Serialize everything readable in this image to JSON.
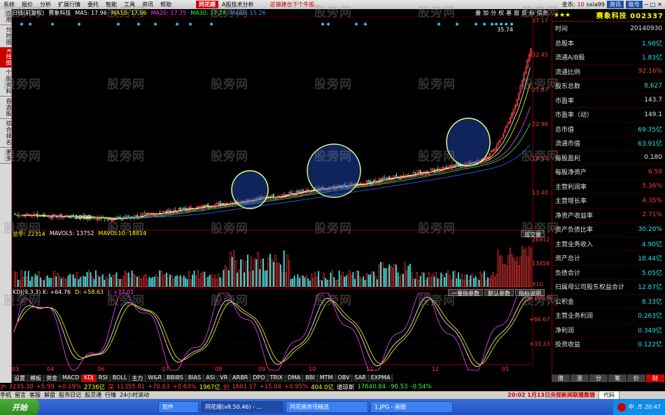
{
  "menu": {
    "items": [
      "系统",
      "报价",
      "分析",
      "扩展行情",
      "委托",
      "智能",
      "工具",
      "资讯",
      "帮助"
    ],
    "brand": "同花顺",
    "subtitle": "A股技术分析",
    "ticker": "这锑建仓下个牛股...",
    "gold_label": "金币:",
    "gold_value": "10",
    "user": "sxia99",
    "zixun": "资讯",
    "account": "账号"
  },
  "left_tabs": [
    {
      "label": "应用",
      "active": false
    },
    {
      "label": "分时图",
      "active": false
    },
    {
      "label": "K线图",
      "active": true
    },
    {
      "label": "个股资料",
      "active": false
    },
    {
      "label": "自选股",
      "active": false
    },
    {
      "label": "综合排名",
      "active": false
    },
    {
      "label": "更多",
      "active": false
    }
  ],
  "ma_bar": {
    "period": "日线(前复权)",
    "name": "赛象科技",
    "ma5": "MA5: 17.96",
    "ma10": "MA10: 17.96",
    "ma20": "MA20: 17.75",
    "ma30": "MA30: 17.28",
    "ma60": "MA60: 15.26",
    "tools": [
      "叠",
      "加",
      "分",
      "权",
      "基",
      "窗",
      "反",
      "标",
      "信息"
    ]
  },
  "price_axis": [
    "37.17",
    "32.45",
    "27.87",
    "22.96",
    "18.10",
    "13.40"
  ],
  "price_marks": {
    "high": "35.74",
    "low": "10.09"
  },
  "vol_bar": {
    "label": "总手: 22314",
    "mavol5": "MAVOL5: 13752",
    "mavol10": "MAVOL10: 18814",
    "selector": "成交量"
  },
  "vol_axis": [
    "26912",
    "13456",
    "X10"
  ],
  "kdj_bar": {
    "label": "KDJ(9,3,3) K: +64.76",
    "d": "D: +58.63",
    "j": "J: +77.01"
  },
  "kdj_buttons": [
    "一量指参数",
    "默认参数",
    "指标说明"
  ],
  "kdj_axis": [
    "+100.00",
    "+66.67",
    "+33.33"
  ],
  "date_axis": [
    "03",
    "04",
    "06",
    "07",
    "08",
    "09",
    "10",
    "11",
    "12",
    "01"
  ],
  "bottom_tabs": [
    {
      "label": "设置",
      "active": false
    },
    {
      "label": "模板",
      "active": false
    },
    {
      "label": "资金",
      "active": false
    },
    {
      "label": "MACD",
      "active": false
    },
    {
      "label": "KDJ",
      "active": true
    },
    {
      "label": "RSI",
      "active": false
    },
    {
      "label": "BOLL",
      "active": false
    },
    {
      "label": "主力",
      "active": false
    },
    {
      "label": "W&R",
      "active": false
    },
    {
      "label": "BBIBS",
      "active": false
    },
    {
      "label": "BIAS",
      "active": false
    },
    {
      "label": "ASI",
      "active": false
    },
    {
      "label": "VR",
      "active": false
    },
    {
      "label": "ARBR",
      "active": false
    },
    {
      "label": "DPO",
      "active": false
    },
    {
      "label": "TRIX",
      "active": false
    },
    {
      "label": "DMA",
      "active": false
    },
    {
      "label": "BBI",
      "active": false
    },
    {
      "label": "MTM",
      "active": false
    },
    {
      "label": "OBV",
      "active": false
    },
    {
      "label": "SAR",
      "active": false
    },
    {
      "label": "EXPMA",
      "active": false
    }
  ],
  "stock_panel": {
    "name": "赛象科技",
    "code": "002337",
    "rows": [
      {
        "label": "时间",
        "value": "20140930",
        "cls": ""
      },
      {
        "label": "总股本",
        "value": "1.98亿",
        "cls": "cyan"
      },
      {
        "label": "流通A/B股",
        "value": "1.83亿",
        "cls": "cyan"
      },
      {
        "label": "流通比例",
        "value": "92.16%",
        "cls": "red"
      },
      {
        "label": "股东总数",
        "value": "8,627",
        "cls": "cyan"
      },
      {
        "label": "市盈率",
        "value": "143.7",
        "cls": ""
      },
      {
        "label": "市盈率（动）",
        "value": "149.1",
        "cls": ""
      },
      {
        "label": "总市值",
        "value": "69.35亿",
        "cls": "cyan"
      },
      {
        "label": "流通市值",
        "value": "63.91亿",
        "cls": "cyan"
      },
      {
        "label": "每股盈利",
        "value": "0.180",
        "cls": ""
      },
      {
        "label": "每股净资产",
        "value": "6.50",
        "cls": "red"
      },
      {
        "label": "主营利润率",
        "value": "5.36%",
        "cls": "red"
      },
      {
        "label": "主营增长率",
        "value": "4.35%",
        "cls": "red"
      },
      {
        "label": "净资产收益率",
        "value": "2.71%",
        "cls": "red"
      },
      {
        "label": "资产负债比率",
        "value": "30.20%",
        "cls": "cyan"
      },
      {
        "label": "主营业务收入",
        "value": "4.90亿",
        "cls": "cyan"
      },
      {
        "label": "资产总计",
        "value": "18.44亿",
        "cls": "cyan"
      },
      {
        "label": "负债合计",
        "value": "5.05亿",
        "cls": "cyan"
      },
      {
        "label": "归属母公司股东权益合计",
        "value": "12.87亿",
        "cls": "cyan"
      },
      {
        "label": "公积金",
        "value": "8.33亿",
        "cls": "cyan"
      },
      {
        "label": "主营业务利润",
        "value": "0.263亿",
        "cls": "cyan"
      },
      {
        "label": "净利润",
        "value": "0.349亿",
        "cls": "cyan"
      },
      {
        "label": "投资收益",
        "value": "0.122亿",
        "cls": "cyan"
      }
    ],
    "tabs": [
      "值",
      "涨",
      "分",
      "笔",
      "价",
      "财"
    ]
  },
  "status": {
    "sh_label": "沪",
    "sh_idx": "3235.30",
    "sh_chg": "+5.99",
    "sh_pct": "+0.19%",
    "sh_amt": "2736亿",
    "sz_label": "深",
    "sz_idx": "11355.81",
    "sz_chg": "+70.63",
    "sz_pct": "+0.63%",
    "sz_amt": "1967亿",
    "cy_label": "创",
    "cy_idx": "1601.17",
    "cy_chg": "+15.04",
    "cy_pct": "+0.95%",
    "cy_amt": "404.0亿",
    "dj_label": "道琼斯",
    "dj_idx": "17640.84",
    "dj_chg": "-96.53",
    "dj_pct": "-0.54%"
  },
  "status2": {
    "items": [
      "手机",
      "留言",
      "客服",
      "解盘",
      "股市日记",
      "股灵通",
      "行情",
      "24小时滚动"
    ],
    "news": "20:02  1月13日央视新闻联播集锦",
    "code_label": "代码"
  },
  "taskbar": {
    "start": "开始",
    "tasks": [
      {
        "label": "软件",
        "active": false
      },
      {
        "label": "同花顺(v8.50.46) - ...",
        "active": true
      },
      {
        "label": "同花顺资讯精选",
        "active": false
      },
      {
        "label": "1.JPG - 画图",
        "active": false
      }
    ],
    "tray_lang": "中",
    "clock": "20:47"
  },
  "watermark": "股旁网",
  "colors": {
    "up": "#ff3c3c",
    "down": "#30e0e0",
    "ma5": "#ffffff",
    "ma10": "#ffff00",
    "ma20": "#ff40ff",
    "ma30": "#30ff30",
    "ma60": "#4060ff",
    "accent": "#c00000"
  }
}
